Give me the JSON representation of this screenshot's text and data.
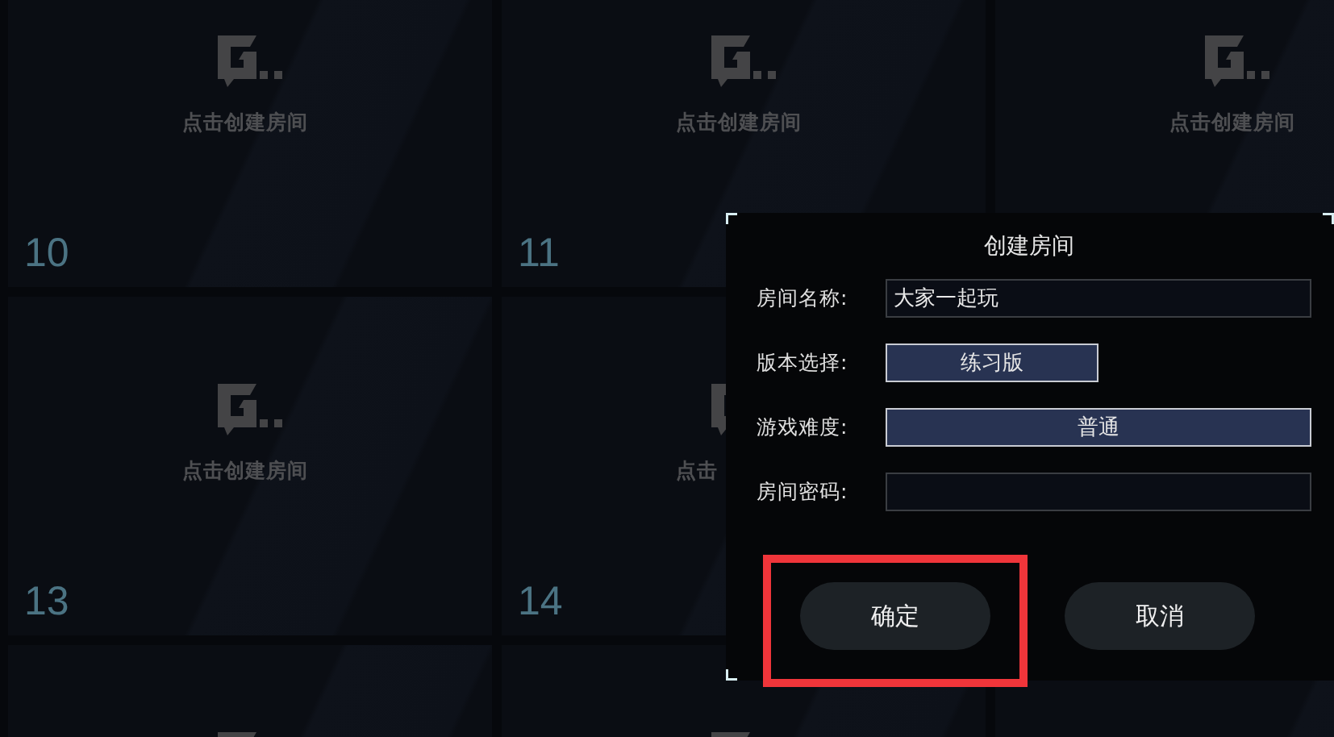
{
  "cards": [
    {
      "number": "10",
      "caption": "点击创建房间",
      "logo": true
    },
    {
      "number": "11",
      "caption": "点击创建房间",
      "logo": true
    },
    {
      "caption": "点击创建房间",
      "logo": true
    },
    {
      "number": "13",
      "caption": "点击创建房间",
      "logo": true
    },
    {
      "number": "14",
      "caption": "点击",
      "logo": true
    },
    {
      "logo": true
    },
    {
      "logo": true
    },
    {
      "logo": false
    }
  ],
  "dialog": {
    "title": "创建房间",
    "fields": [
      {
        "kind": "text",
        "label": "房间名称:",
        "value": "大家一起玩"
      },
      {
        "kind": "option",
        "label": "版本选择:",
        "value": "练习版"
      },
      {
        "kind": "select",
        "label": "游戏难度:",
        "value": "普通"
      },
      {
        "kind": "password",
        "label": "房间密码:"
      }
    ],
    "buttons": [
      {
        "label": "确定",
        "highlighted": true
      },
      {
        "label": "取消",
        "highlighted": false
      }
    ]
  }
}
